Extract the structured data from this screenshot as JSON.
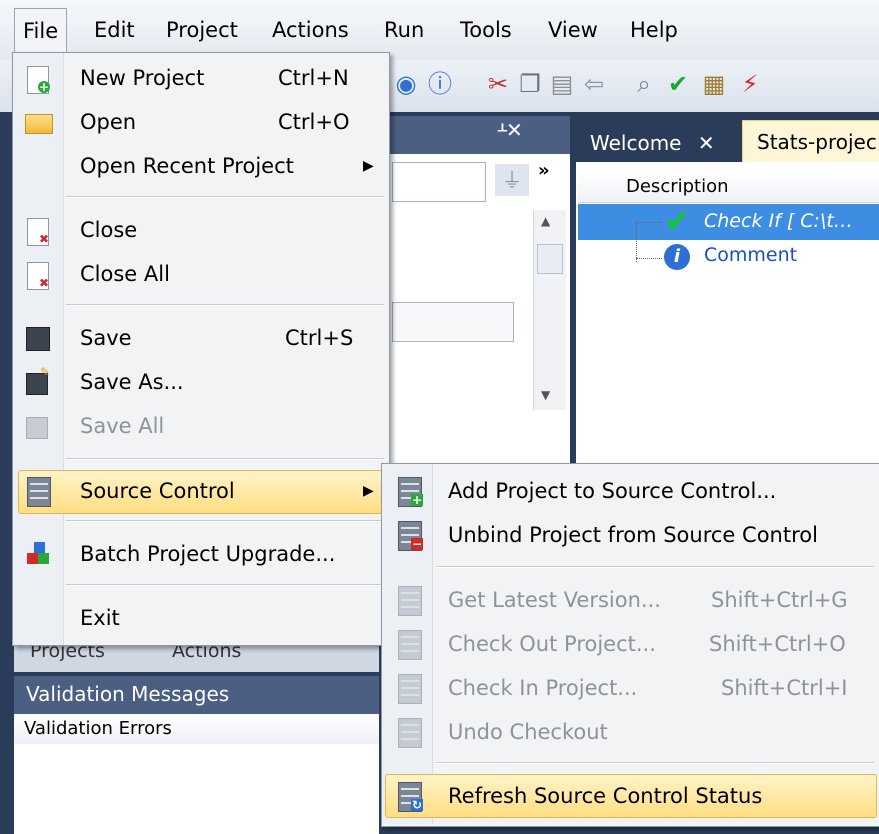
{
  "menubar": {
    "items": [
      "File",
      "Edit",
      "Project",
      "Actions",
      "Run",
      "Tools",
      "View",
      "Help"
    ]
  },
  "file_menu": {
    "items": [
      {
        "label": "New Project",
        "shortcut": "Ctrl+N",
        "icon": "new-project-icon",
        "enabled": true
      },
      {
        "label": "Open",
        "shortcut": "Ctrl+O",
        "icon": "folder-open-icon",
        "enabled": true
      },
      {
        "label": "Open Recent Project",
        "shortcut": "",
        "icon": "",
        "enabled": true,
        "submenu": true
      },
      {
        "label": "Close",
        "shortcut": "",
        "icon": "close-document-icon",
        "enabled": true
      },
      {
        "label": "Close All",
        "shortcut": "",
        "icon": "close-all-icon",
        "enabled": true
      },
      {
        "label": "Save",
        "shortcut": "Ctrl+S",
        "icon": "save-icon",
        "enabled": true
      },
      {
        "label": "Save As...",
        "shortcut": "",
        "icon": "save-as-icon",
        "enabled": true
      },
      {
        "label": "Save All",
        "shortcut": "",
        "icon": "save-all-icon",
        "enabled": false
      },
      {
        "label": "Source Control",
        "shortcut": "",
        "icon": "source-control-icon",
        "enabled": true,
        "submenu": true,
        "highlighted": true
      },
      {
        "label": "Batch Project Upgrade...",
        "shortcut": "",
        "icon": "batch-upgrade-icon",
        "enabled": true
      },
      {
        "label": "Exit",
        "shortcut": "",
        "icon": "",
        "enabled": true
      }
    ]
  },
  "source_control_menu": {
    "items": [
      {
        "label": "Add Project to Source Control...",
        "shortcut": "",
        "enabled": true
      },
      {
        "label": "Unbind Project from Source Control",
        "shortcut": "",
        "enabled": true
      },
      {
        "label": "Get Latest Version...",
        "shortcut": "Shift+Ctrl+G",
        "enabled": false
      },
      {
        "label": "Check Out Project...",
        "shortcut": "Shift+Ctrl+O",
        "enabled": false
      },
      {
        "label": "Check In Project...",
        "shortcut": "Shift+Ctrl+I",
        "enabled": false
      },
      {
        "label": "Undo Checkout",
        "shortcut": "",
        "enabled": false
      },
      {
        "label": "Refresh Source Control Status",
        "shortcut": "",
        "enabled": true,
        "highlighted": true
      }
    ]
  },
  "doc_tabs": {
    "welcome": "Welcome",
    "close_glyph": "✕",
    "stats": "Stats-projec"
  },
  "description_panel": {
    "header": "Description",
    "rows": [
      {
        "label": "Check If [ C:\\t…",
        "icon": "check-icon"
      },
      {
        "label": "Comment",
        "icon": "info-icon"
      }
    ]
  },
  "bottom_panel": {
    "tab_partials": [
      "Projects",
      "Actions"
    ],
    "title": "Validation Messages",
    "subheader": "Validation Errors"
  },
  "colors": {
    "menu_highlight": "#ffde82",
    "selection_blue": "#3d8ee3",
    "panel_header": "#4a5f82"
  }
}
